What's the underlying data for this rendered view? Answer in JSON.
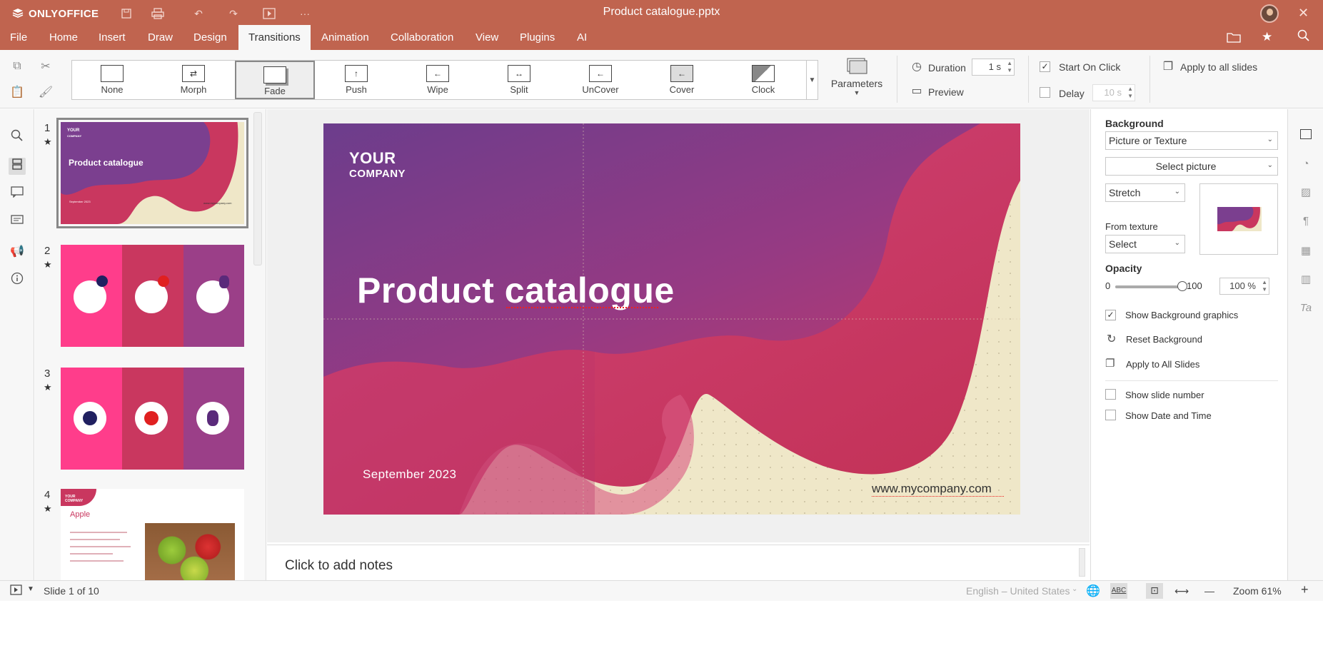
{
  "app": {
    "name": "ONLYOFFICE",
    "document_title": "Product catalogue.pptx"
  },
  "colors": {
    "brand": "#c0644f",
    "slide_purple": "#7b3f8f",
    "slide_magenta": "#c9375f",
    "slide_cream": "#efe7c8"
  },
  "menu": {
    "tabs": [
      "File",
      "Home",
      "Insert",
      "Draw",
      "Design",
      "Transitions",
      "Animation",
      "Collaboration",
      "View",
      "Plugins",
      "AI"
    ],
    "active": "Transitions"
  },
  "toolbar": {
    "transitions": [
      {
        "label": "None",
        "icon": "none-icon"
      },
      {
        "label": "Morph",
        "icon": "morph-icon"
      },
      {
        "label": "Fade",
        "icon": "fade-icon"
      },
      {
        "label": "Push",
        "icon": "push-icon"
      },
      {
        "label": "Wipe",
        "icon": "wipe-icon"
      },
      {
        "label": "Split",
        "icon": "split-icon"
      },
      {
        "label": "UnCover",
        "icon": "uncover-icon"
      },
      {
        "label": "Cover",
        "icon": "cover-icon"
      },
      {
        "label": "Clock",
        "icon": "clock-icon"
      }
    ],
    "selected_transition": "Fade",
    "parameters_label": "Parameters",
    "duration_label": "Duration",
    "duration_value": "1 s",
    "preview_label": "Preview",
    "start_on_click_label": "Start On Click",
    "start_on_click_checked": true,
    "delay_label": "Delay",
    "delay_value": "10 s",
    "delay_checked": false,
    "apply_all_label": "Apply to all slides"
  },
  "thumbnails": [
    {
      "num": "1",
      "title": "Product catalogue",
      "company_line1": "YOUR",
      "company_line2": "COMPANY",
      "date": "September 2023",
      "url": "www.mycompany.com"
    },
    {
      "num": "2"
    },
    {
      "num": "3"
    },
    {
      "num": "4",
      "title": "Apple",
      "company_line1": "YOUR",
      "company_line2": "COMPANY"
    }
  ],
  "slide": {
    "company_line1": "YOUR",
    "company_line2": "COMPANY",
    "title": "Product catalogue",
    "date": "September 2023",
    "url": "www.mycompany.com"
  },
  "notes_placeholder": "Click to add notes",
  "right_panel": {
    "background_label": "Background",
    "fill_type": "Picture or Texture",
    "select_picture_label": "Select picture",
    "stretch_value": "Stretch",
    "from_texture_label": "From texture",
    "texture_value": "Select",
    "opacity_label": "Opacity",
    "opacity_min": "0",
    "opacity_max": "100",
    "opacity_value": "100 %",
    "opacity_fraction": 1.0,
    "show_bg_graphics_label": "Show Background graphics",
    "show_bg_graphics_checked": true,
    "reset_bg_label": "Reset Background",
    "apply_all_label": "Apply to All Slides",
    "show_slide_number_label": "Show slide number",
    "show_date_time_label": "Show Date and Time"
  },
  "status": {
    "slide_info": "Slide 1 of 10",
    "language": "English – United States",
    "zoom": "Zoom 61%"
  }
}
